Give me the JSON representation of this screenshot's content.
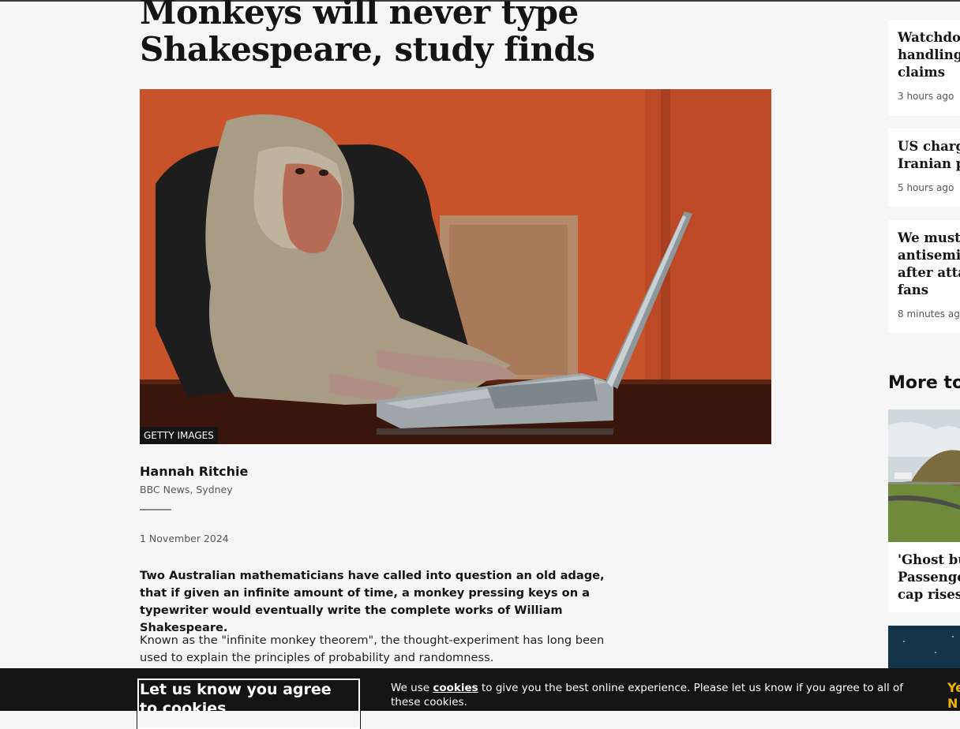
{
  "article": {
    "headline": "Monkeys will never type Shakespeare, study finds",
    "image_credit": "GETTY IMAGES",
    "author": "Hannah Ritchie",
    "role": "BBC News, Sydney",
    "date": "1 November 2024",
    "lede": "Two Australian mathematicians have called into question an old adage, that if given an infinite amount of time, a monkey pressing keys on a typewriter would eventually write the complete works of William Shakespeare.",
    "paragraph_1": "Known as the \"infinite monkey theorem\", the thought-experiment has long been used to explain the principles of probability and randomness."
  },
  "sidebar": {
    "top_stories": [
      {
        "title": "Watchdog\nhandling\nclaims",
        "time": "3 hours ago"
      },
      {
        "title": "US charg\nIranian p",
        "time": "5 hours ago"
      },
      {
        "title": "We must\nantisemit\nafter atta\nfans",
        "time": "8 minutes ago"
      }
    ],
    "more_heading": "More to",
    "more_items": [
      {
        "title": "'Ghost bu\nPassenge\ncap rises"
      }
    ]
  },
  "cookie_banner": {
    "title": "Let us know you agree to cookies",
    "text_before": "We use ",
    "link": "cookies",
    "text_after": " to give you the best online experience. Please let us know if you agree to all of these cookies.",
    "yes_label": "Ye",
    "no_label": "N"
  }
}
